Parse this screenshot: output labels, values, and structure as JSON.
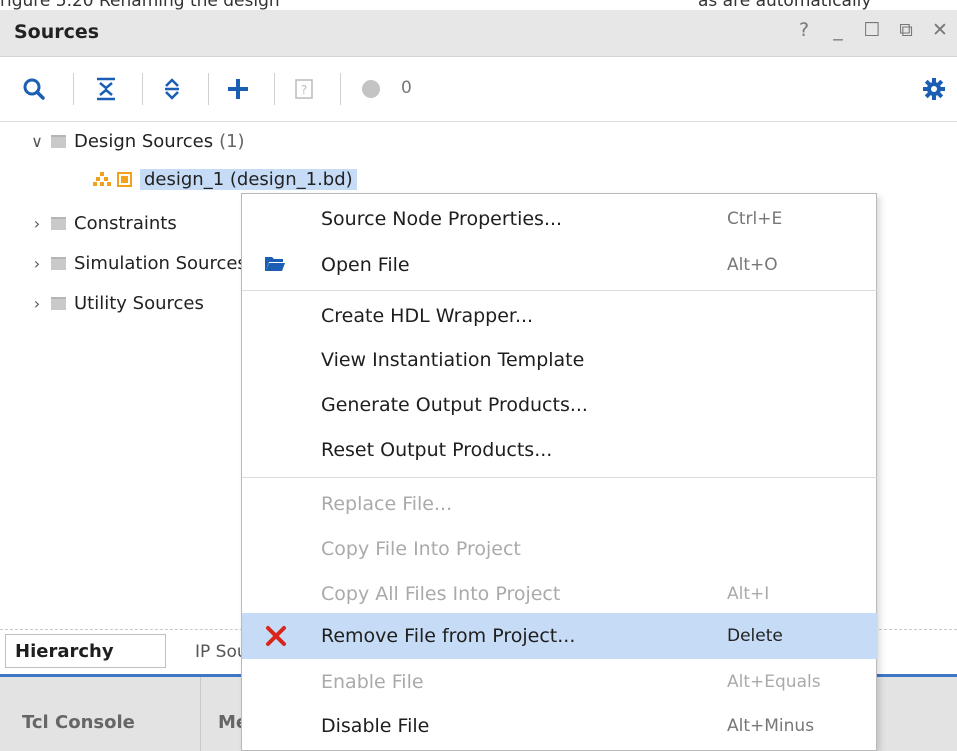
{
  "top_strip": {
    "t1": "rigure 5.20 Renaming the design",
    "t2": "as are automatically"
  },
  "window": {
    "title": "Sources",
    "controls": [
      "?",
      "_",
      "☐",
      "⧉",
      "✕"
    ]
  },
  "toolbar": {
    "count": "0"
  },
  "tree": {
    "design_sources_label": "Design Sources",
    "design_sources_count": "(1)",
    "design_file": "design_1 (design_1.bd)",
    "constraints_label": "Constraints",
    "simulation_label": "Simulation Sources",
    "utility_label": "Utility Sources"
  },
  "bottom": {
    "tab_hierarchy": "Hierarchy",
    "tab_ip": "IP Sources",
    "tab_tcl": "Tcl Console",
    "tab_m": "Messages"
  },
  "menu": {
    "items": [
      {
        "label": "Source Node Properties...",
        "shortcut": "Ctrl+E"
      },
      {
        "label": "Open File",
        "shortcut": "Alt+O"
      },
      {
        "label": "Create HDL Wrapper...",
        "shortcut": ""
      },
      {
        "label": "View Instantiation Template",
        "shortcut": ""
      },
      {
        "label": "Generate Output Products...",
        "shortcut": ""
      },
      {
        "label": "Reset Output Products...",
        "shortcut": ""
      },
      {
        "label": "Replace File...",
        "shortcut": ""
      },
      {
        "label": "Copy File Into Project",
        "shortcut": ""
      },
      {
        "label": "Copy All Files Into Project",
        "shortcut": "Alt+I"
      },
      {
        "label": "Remove File from Project...",
        "shortcut": "Delete"
      },
      {
        "label": "Enable File",
        "shortcut": "Alt+Equals"
      },
      {
        "label": "Disable File",
        "shortcut": "Alt+Minus"
      }
    ]
  },
  "colors": {
    "selection": "#c6dcf6",
    "accent_blue": "#1a5fb4",
    "remove_red": "#d8261c",
    "ip_orange": "#f5a01a"
  }
}
